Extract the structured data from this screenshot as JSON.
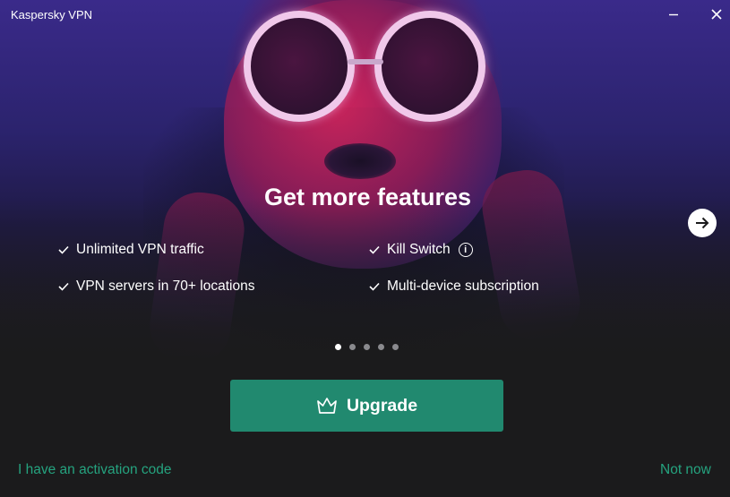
{
  "window": {
    "title": "Kaspersky VPN",
    "minimize_icon": "minimize-icon",
    "close_icon": "close-icon"
  },
  "carousel": {
    "headline": "Get more features",
    "features": [
      {
        "label": "Unlimited VPN traffic",
        "icon": "checkmark-icon"
      },
      {
        "label": "VPN servers in 70+ locations",
        "icon": "checkmark-icon"
      },
      {
        "label": "Kill Switch",
        "icon": "checkmark-icon",
        "info_icon": "info-icon"
      },
      {
        "label": "Multi-device subscription",
        "icon": "checkmark-icon"
      }
    ],
    "next_icon": "arrow-right-icon",
    "page_count": 5,
    "active_page": 1
  },
  "actions": {
    "upgrade_label": "Upgrade",
    "upgrade_icon": "crown-icon",
    "activation_link": "I have an activation code",
    "not_now_link": "Not now"
  },
  "colors": {
    "background": "#1b1b1c",
    "accent_button": "#21896f",
    "link": "#25a37f",
    "text": "#ffffff"
  }
}
